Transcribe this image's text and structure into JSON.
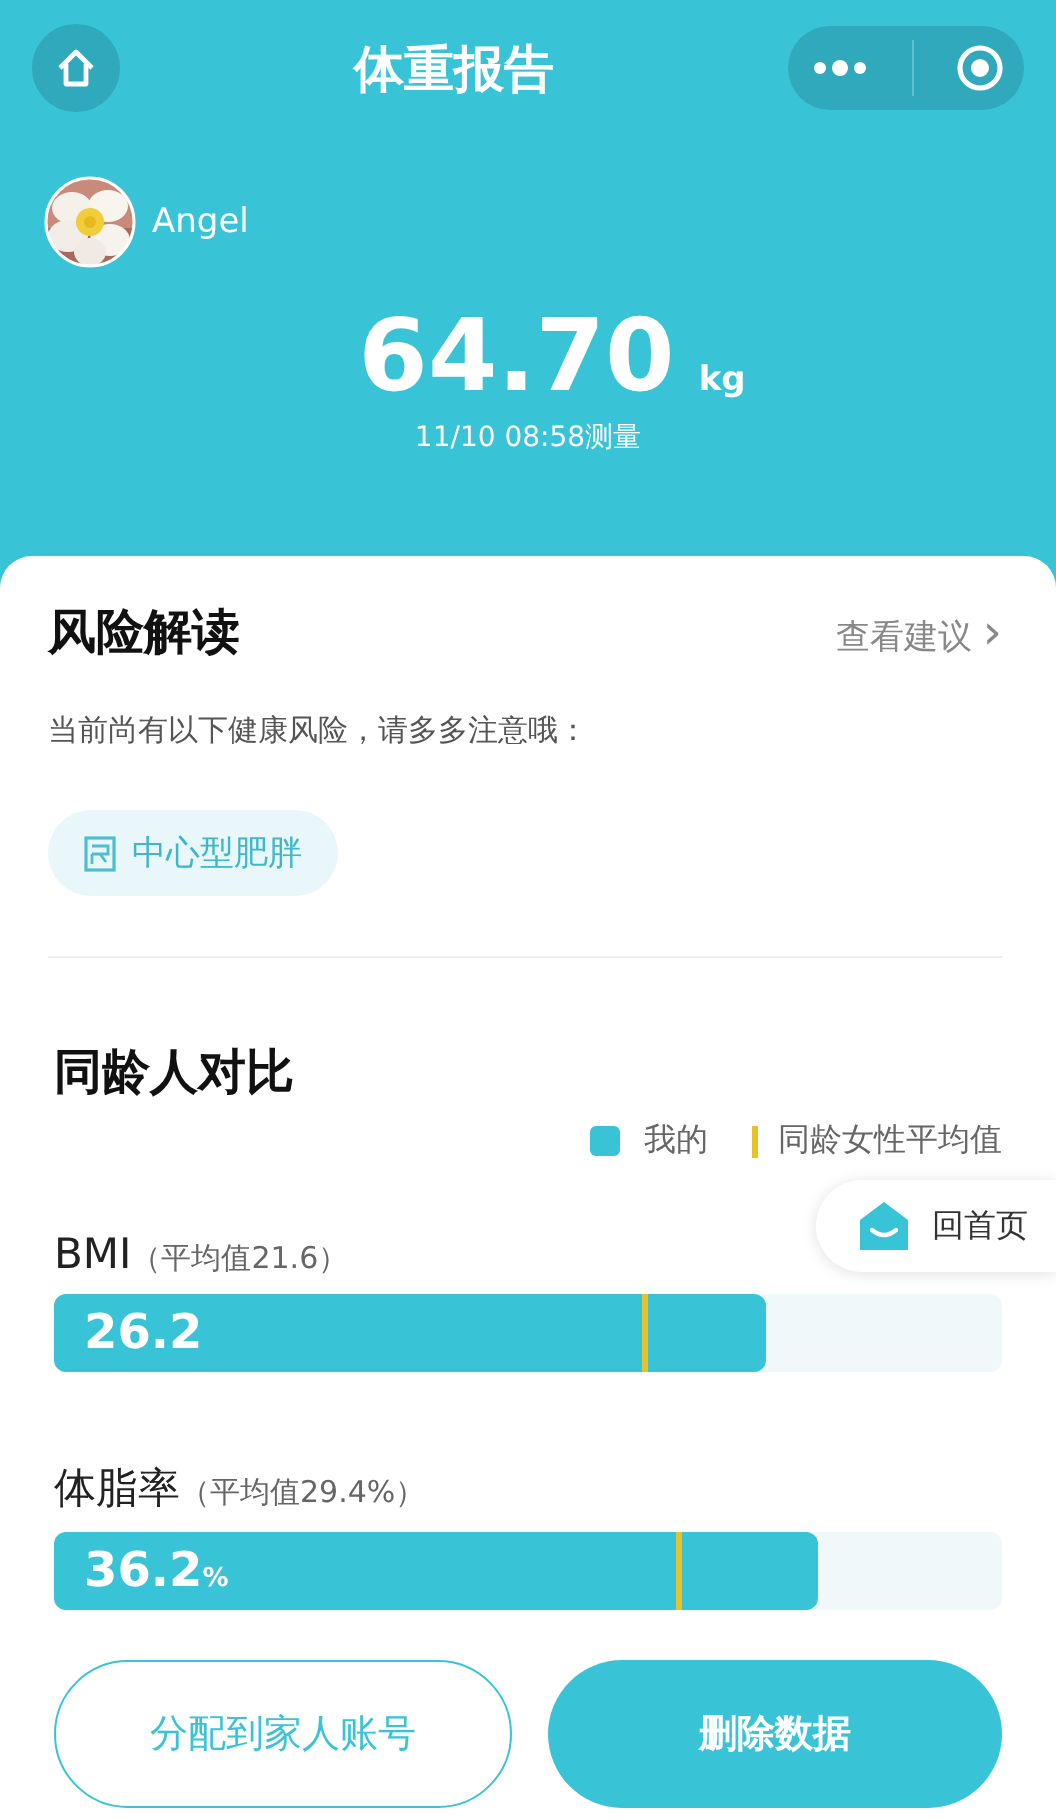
{
  "header": {
    "title": "体重报告",
    "user_name": "Angel",
    "weight": "64.70",
    "unit": "kg",
    "measured_at": "11/10 08:58测量"
  },
  "risk": {
    "title": "风险解读",
    "link": "查看建议",
    "link_chevron": "›",
    "note": "当前尚有以下健康风险，请多多注意哦：",
    "tags": [
      "中心型肥胖"
    ]
  },
  "comparison": {
    "title": "同龄人对比",
    "legend": [
      {
        "kind": "swatch",
        "label": "我的",
        "color": "#38c3d6"
      },
      {
        "kind": "line",
        "label": "同龄女性平均值",
        "color": "#e8c228"
      }
    ],
    "metrics": [
      {
        "name": "BMI",
        "average": "（平均值21.6）",
        "value": "26.2",
        "level": 0.75,
        "average_marker": {
          "level": 0.62
        }
      },
      {
        "name": "体脂率",
        "average": "（平均值29.4%）",
        "value": "36.2",
        "unit": "%",
        "level": 0.805,
        "average_marker": {
          "level": 0.657
        }
      }
    ]
  },
  "home_button": {
    "label": "回首页"
  },
  "buttons": [
    {
      "label": "分配到家人账号",
      "kind": "outline"
    },
    {
      "label": "删除数据",
      "kind": "filled"
    }
  ]
}
